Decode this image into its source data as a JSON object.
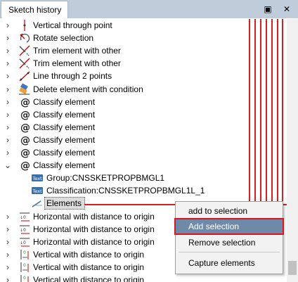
{
  "panel": {
    "title": "Sketch history",
    "pin_glyph": "▣",
    "close_glyph": "✕"
  },
  "tree": {
    "items": [
      {
        "label": "Vertical through point",
        "icon": "vertical-line-icon",
        "expand": "›"
      },
      {
        "label": "Rotate selection",
        "icon": "rotate-icon",
        "expand": "›"
      },
      {
        "label": "Trim element with other",
        "icon": "trim-icon",
        "expand": "›"
      },
      {
        "label": "Trim element with other",
        "icon": "trim-icon",
        "expand": "›"
      },
      {
        "label": "Line through 2 points",
        "icon": "line-icon",
        "expand": "›"
      },
      {
        "label": "Delete element with condition",
        "icon": "eraser-icon",
        "expand": "›"
      },
      {
        "label": "Classify element",
        "icon": "at-icon",
        "expand": "›"
      },
      {
        "label": "Classify element",
        "icon": "at-icon",
        "expand": "›"
      },
      {
        "label": "Classify element",
        "icon": "at-icon",
        "expand": "›"
      },
      {
        "label": "Classify element",
        "icon": "at-icon",
        "expand": "›"
      },
      {
        "label": "Classify element",
        "icon": "at-icon",
        "expand": "›"
      },
      {
        "label": "Classify element",
        "icon": "at-icon",
        "expand": "⌄"
      },
      {
        "label": "Group:CNSSKETPROPBMGL1",
        "icon": "text-tag-icon",
        "expand": ""
      },
      {
        "label": "Classification:CNSSKETPROPBMGL1L_1",
        "icon": "text-tag-icon",
        "expand": ""
      },
      {
        "label": "Elements",
        "icon": "elements-icon",
        "expand": ""
      },
      {
        "label": "Horizontal with distance to origin",
        "icon": "h-distance-icon",
        "expand": "›"
      },
      {
        "label": "Horizontal with distance to origin",
        "icon": "h-distance-icon",
        "expand": "›"
      },
      {
        "label": "Horizontal with distance to origin",
        "icon": "h-distance-icon",
        "expand": "›"
      },
      {
        "label": "Vertical with distance to origin",
        "icon": "v-distance-icon",
        "expand": "›"
      },
      {
        "label": "Vertical with distance to origin",
        "icon": "v-distance-icon",
        "expand": "›"
      },
      {
        "label": "Vertical with distance to origin",
        "icon": "v-distance-icon",
        "expand": "›"
      }
    ],
    "at_symbol": "@",
    "text_tag": "Text"
  },
  "context_menu": {
    "items": [
      "add to selection",
      "Add selection",
      "Remove selection",
      "Capture elements"
    ]
  },
  "colors": {
    "highlight": "#6f8aa8",
    "annotation_red": "#d32020",
    "titlebar": "#bfcddb"
  }
}
